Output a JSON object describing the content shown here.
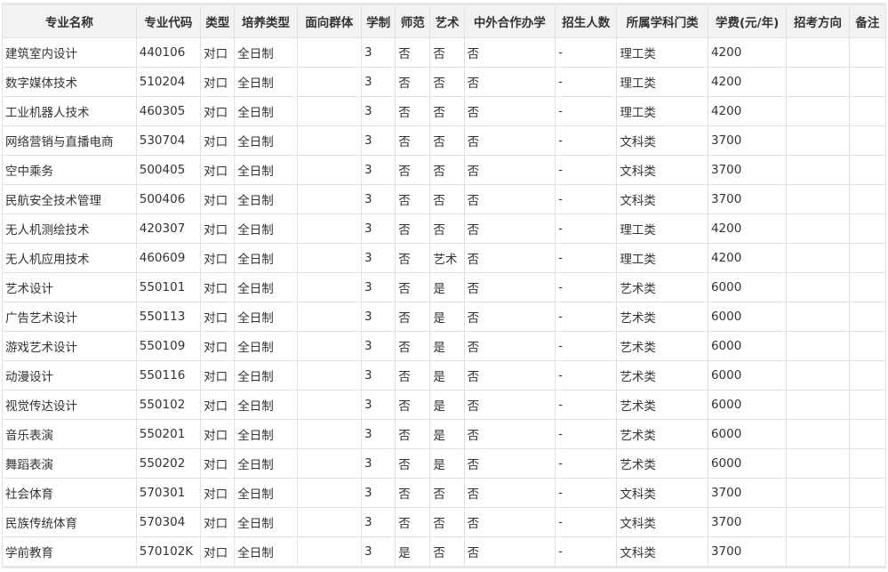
{
  "headers": [
    "专业名称",
    "专业代码",
    "类型",
    "培养类型",
    "面向群体",
    "学制",
    "师范",
    "艺术",
    "中外合作办学",
    "招生人数",
    "所属学科门类",
    "学费(元/年)",
    "招考方向",
    "备注"
  ],
  "rows": [
    [
      "建筑室内设计",
      "440106",
      "对口",
      "全日制",
      "",
      "3",
      "否",
      "否",
      "否",
      "-",
      "理工类",
      "4200",
      "",
      ""
    ],
    [
      "数字媒体技术",
      "510204",
      "对口",
      "全日制",
      "",
      "3",
      "否",
      "否",
      "否",
      "-",
      "理工类",
      "4200",
      "",
      ""
    ],
    [
      "工业机器人技术",
      "460305",
      "对口",
      "全日制",
      "",
      "3",
      "否",
      "否",
      "否",
      "-",
      "理工类",
      "4200",
      "",
      ""
    ],
    [
      "网络营销与直播电商",
      "530704",
      "对口",
      "全日制",
      "",
      "3",
      "否",
      "否",
      "否",
      "-",
      "文科类",
      "3700",
      "",
      ""
    ],
    [
      "空中乘务",
      "500405",
      "对口",
      "全日制",
      "",
      "3",
      "否",
      "否",
      "否",
      "-",
      "文科类",
      "3700",
      "",
      ""
    ],
    [
      "民航安全技术管理",
      "500406",
      "对口",
      "全日制",
      "",
      "3",
      "否",
      "否",
      "否",
      "-",
      "文科类",
      "3700",
      "",
      ""
    ],
    [
      "无人机测绘技术",
      "420307",
      "对口",
      "全日制",
      "",
      "3",
      "否",
      "否",
      "否",
      "-",
      "理工类",
      "4200",
      "",
      ""
    ],
    [
      "无人机应用技术",
      "460609",
      "对口",
      "全日制",
      "",
      "3",
      "否",
      "艺术",
      "否",
      "-",
      "理工类",
      "4200",
      "",
      ""
    ],
    [
      "艺术设计",
      "550101",
      "对口",
      "全日制",
      "",
      "3",
      "否",
      "是",
      "否",
      "-",
      "艺术类",
      "6000",
      "",
      ""
    ],
    [
      "广告艺术设计",
      "550113",
      "对口",
      "全日制",
      "",
      "3",
      "否",
      "是",
      "否",
      "-",
      "艺术类",
      "6000",
      "",
      ""
    ],
    [
      "游戏艺术设计",
      "550109",
      "对口",
      "全日制",
      "",
      "3",
      "否",
      "是",
      "否",
      "-",
      "艺术类",
      "6000",
      "",
      ""
    ],
    [
      "动漫设计",
      "550116",
      "对口",
      "全日制",
      "",
      "3",
      "否",
      "是",
      "否",
      "-",
      "艺术类",
      "6000",
      "",
      ""
    ],
    [
      "视觉传达设计",
      "550102",
      "对口",
      "全日制",
      "",
      "3",
      "否",
      "是",
      "否",
      "-",
      "艺术类",
      "6000",
      "",
      ""
    ],
    [
      "音乐表演",
      "550201",
      "对口",
      "全日制",
      "",
      "3",
      "否",
      "是",
      "否",
      "-",
      "艺术类",
      "6000",
      "",
      ""
    ],
    [
      "舞蹈表演",
      "550202",
      "对口",
      "全日制",
      "",
      "3",
      "否",
      "是",
      "否",
      "-",
      "艺术类",
      "6000",
      "",
      ""
    ],
    [
      "社会体育",
      "570301",
      "对口",
      "全日制",
      "",
      "3",
      "否",
      "否",
      "否",
      "-",
      "文科类",
      "3700",
      "",
      ""
    ],
    [
      "民族传统体育",
      "570304",
      "对口",
      "全日制",
      "",
      "3",
      "否",
      "否",
      "否",
      "-",
      "文科类",
      "3700",
      "",
      ""
    ],
    [
      "学前教育",
      "570102K",
      "对口",
      "全日制",
      "",
      "3",
      "是",
      "否",
      "否",
      "-",
      "文科类",
      "3700",
      "",
      ""
    ]
  ]
}
